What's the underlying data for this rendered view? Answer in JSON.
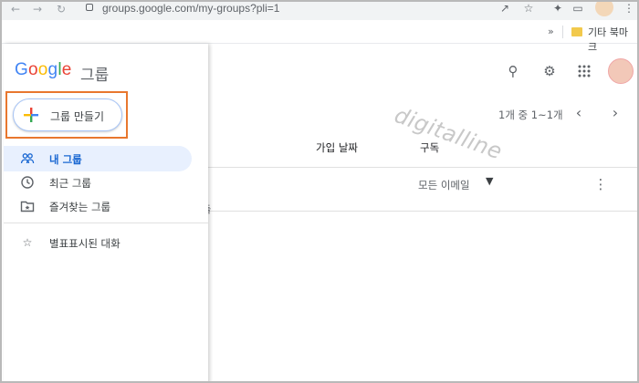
{
  "browser": {
    "url": "groups.google.com/my-groups?pli=1",
    "bookmarks_folder": "기타 북마크",
    "bookmarks_overflow": "»"
  },
  "app": {
    "logo_text": "Google",
    "logo_suffix": "그룹"
  },
  "sidebar": {
    "create_button": "그룹 만들기",
    "items": [
      {
        "label": "내 그룹",
        "icon": "people-icon",
        "active": true
      },
      {
        "label": "최근 그룹",
        "icon": "clock-icon",
        "active": false
      },
      {
        "label": "즐겨찾는 그룹",
        "icon": "folder-star-icon",
        "active": false
      },
      {
        "label": "별표표시된 대화",
        "icon": "star-icon",
        "active": false
      }
    ]
  },
  "main": {
    "watermark": "digitalline",
    "pagination": "1개 중 1~1개",
    "columns": {
      "joined": "가입 날짜",
      "subscription": "구독"
    },
    "rows": [
      {
        "partial_text": "람들",
        "subscription": "모든 이메일"
      }
    ]
  },
  "colors": {
    "accent": "#1967d2",
    "active_bg": "#e8f0fe",
    "highlight_outline": "#e8772e"
  }
}
